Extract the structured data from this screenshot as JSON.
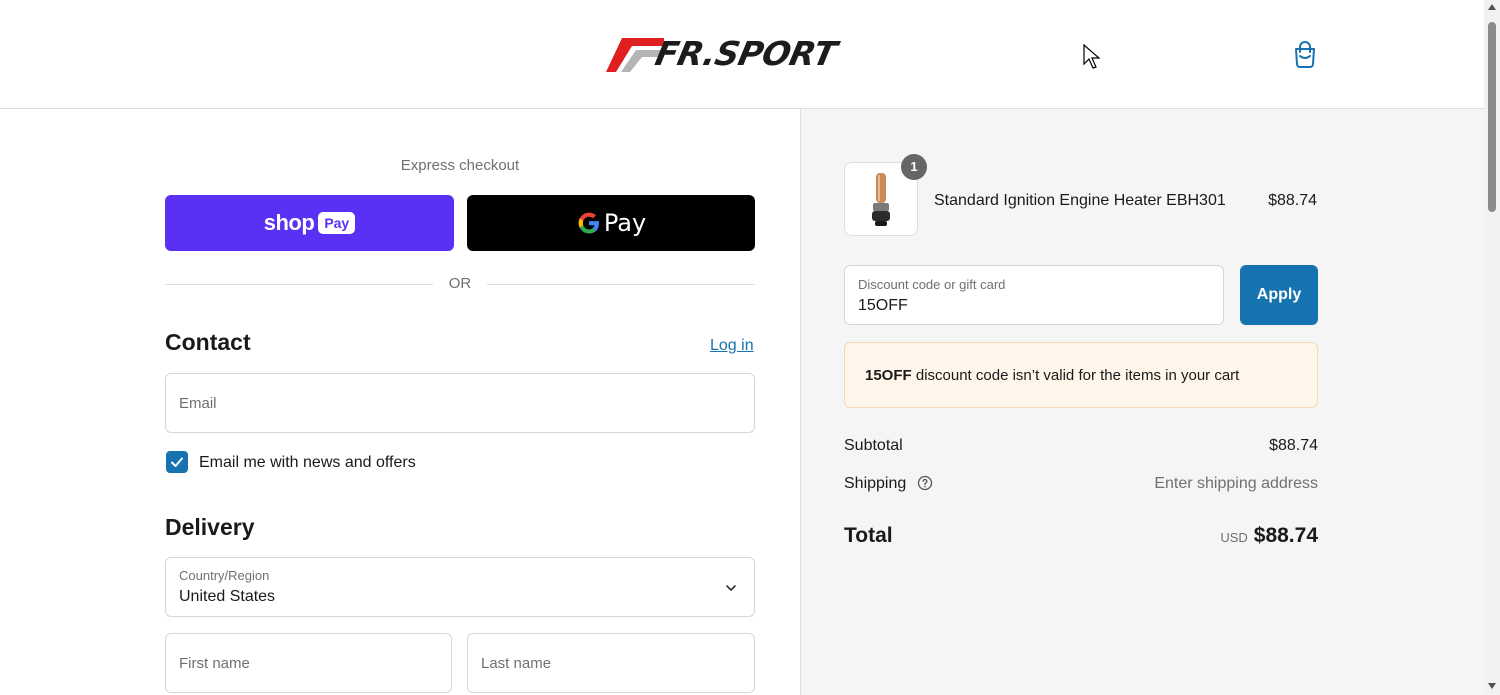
{
  "header": {
    "brand": "FR.SPORT",
    "cart_icon": "shopping-bag-icon"
  },
  "express": {
    "title": "Express checkout",
    "shop_pay_word": "shop",
    "shop_pay_badge": "Pay",
    "gpay_text": "Pay",
    "or_text": "OR"
  },
  "contact": {
    "title": "Contact",
    "login_link": "Log in",
    "email_placeholder": "Email",
    "newsletter_label": "Email me with news and offers",
    "newsletter_checked": true
  },
  "delivery": {
    "title": "Delivery",
    "country_label": "Country/Region",
    "country_value": "United States",
    "first_name_placeholder": "First name",
    "last_name_placeholder": "Last name"
  },
  "order": {
    "items": [
      {
        "name": "Standard Ignition Engine Heater EBH301",
        "price": "$88.74",
        "quantity": "1"
      }
    ],
    "discount_label": "Discount code or gift card",
    "discount_value": "15OFF",
    "apply_label": "Apply",
    "warning_code": "15OFF",
    "warning_message": " discount code isn’t valid for the items in your cart",
    "subtotal_label": "Subtotal",
    "subtotal_value": "$88.74",
    "shipping_label": "Shipping",
    "shipping_value": "Enter shipping address",
    "total_label": "Total",
    "total_currency": "USD",
    "total_value": "$88.74"
  },
  "colors": {
    "accent": "#1773b0",
    "shop_pay": "#5a31f4",
    "logo_red": "#e02020",
    "warning_bg": "#fff5ea"
  }
}
